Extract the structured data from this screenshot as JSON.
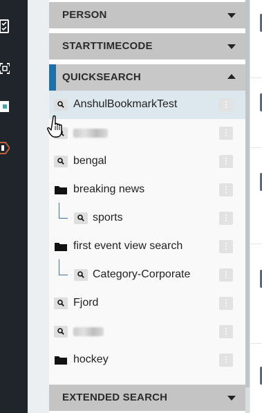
{
  "filters": {
    "sections": [
      {
        "title": "PERSON",
        "state": "collapsed"
      },
      {
        "title": "STARTTIMECODE",
        "state": "collapsed"
      },
      {
        "title": "QUICKSEARCH",
        "state": "expanded"
      }
    ],
    "footer_section": {
      "title": "EXTENDED SEARCH",
      "state": "collapsed"
    }
  },
  "quicksearch": {
    "items": [
      {
        "label": "AnshulBookmarkTest",
        "icon": "search-icon",
        "highlighted": true
      },
      {
        "label": "",
        "icon": "search-icon",
        "redacted": true
      },
      {
        "label": "bengal",
        "icon": "search-icon"
      },
      {
        "label": "breaking news",
        "icon": "folder-icon"
      },
      {
        "label": "sports",
        "icon": "search-icon",
        "child": true
      },
      {
        "label": "first event view search",
        "icon": "folder-icon"
      },
      {
        "label": "Category-Corporate",
        "icon": "search-icon",
        "child": true
      },
      {
        "label": "Fjord",
        "icon": "search-icon"
      },
      {
        "label": "",
        "icon": "search-icon",
        "redacted": true
      },
      {
        "label": "hockey",
        "icon": "folder-icon"
      }
    ]
  },
  "colors": {
    "accent": "#1f6fa8",
    "header_bg": "#c4c4c4",
    "highlight_bg": "#dde8ee",
    "rail_bg": "#1f252b"
  }
}
